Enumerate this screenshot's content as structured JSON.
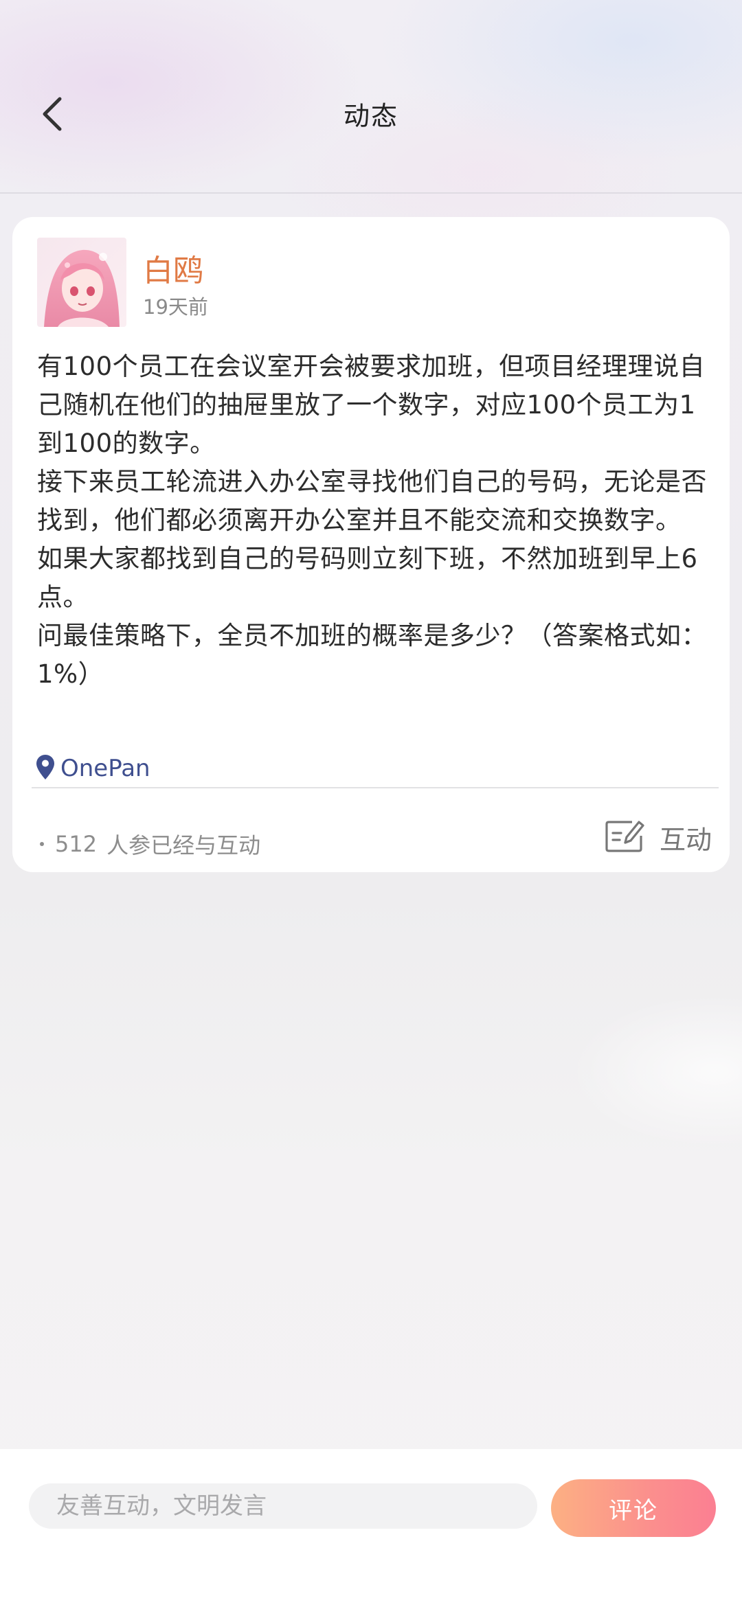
{
  "header": {
    "title": "动态",
    "back_icon": "chevron-left-icon"
  },
  "post": {
    "author": {
      "name": "白鸥",
      "name_color": "#e07a45"
    },
    "time": "19天前",
    "paragraphs": [
      "有100个员工在会议室开会被要求加班，但项目经理理说自己随机在他们的抽屉里放了一个数字，对应100个员工为1到100的数字。",
      "接下来员工轮流进入办公室寻找他们自己的号码，无论是否找到，他们都必须离开办公室并且不能交流和交换数字。",
      "如果大家都找到自己的号码则立刻下班，不然加班到早上6点。",
      "问最佳策略下，全员不加班的概率是多少？（答案格式如：1%）"
    ],
    "location": {
      "icon": "location-pin-icon",
      "text": "OnePan",
      "color": "#3f4f8f"
    },
    "participants": {
      "count": "512",
      "label": "人参已经与互动"
    },
    "interact": {
      "icon": "edit-note-icon",
      "label": "互动"
    }
  },
  "bottom_bar": {
    "comment_placeholder": "友善互动，文明发言",
    "comment_button": "评论",
    "accent_color": "#fb8f8d"
  }
}
